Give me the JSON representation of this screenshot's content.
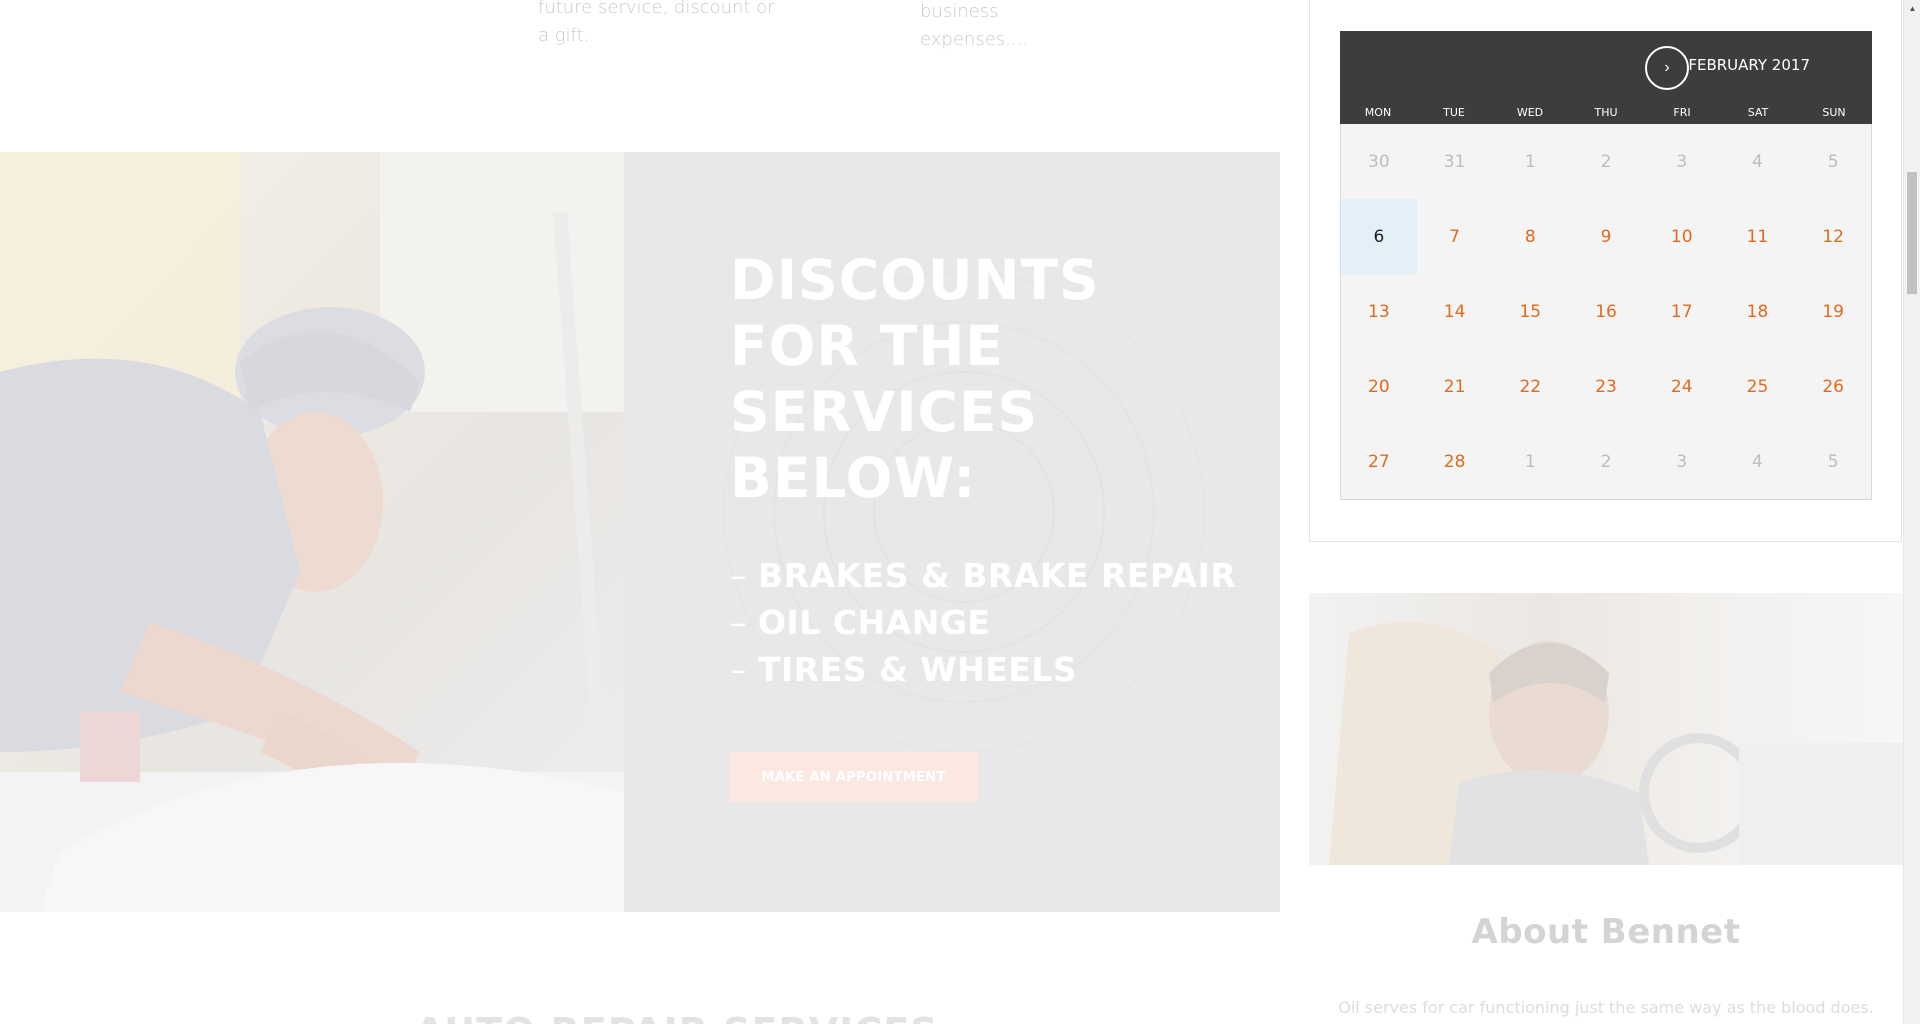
{
  "features": {
    "left_text": "future service, discount or a gift.",
    "right_text": "business expenses...."
  },
  "promo": {
    "title": "DISCOUNTS FOR THE SERVICES BELOW:",
    "services": [
      "BRAKES & BRAKE REPAIR",
      "OIL CHANGE",
      "TIRES & WHEELS"
    ],
    "button_label": "MAKE AN APPOINTMENT"
  },
  "section_heading": "AUTO REPAIR SERVICES",
  "calendar": {
    "month_label": "FEBRUARY 2017",
    "next_icon": "chevron-right-icon",
    "weekdays": [
      "MON",
      "TUE",
      "WED",
      "THU",
      "FRI",
      "SAT",
      "SUN"
    ],
    "weeks": [
      [
        "30",
        "31",
        "1",
        "2",
        "3",
        "4",
        "5"
      ],
      [
        "6",
        "7",
        "8",
        "9",
        "10",
        "11",
        "12"
      ],
      [
        "13",
        "14",
        "15",
        "16",
        "17",
        "18",
        "19"
      ],
      [
        "20",
        "21",
        "22",
        "23",
        "24",
        "25",
        "26"
      ],
      [
        "27",
        "28",
        "1",
        "2",
        "3",
        "4",
        "5"
      ]
    ],
    "today": "6",
    "colors": {
      "header_bg": "#3d3d3d",
      "day_link": "#e26a1e",
      "muted": "#bdbdbd",
      "today_bg": "#e4f0f8"
    }
  },
  "about": {
    "title": "About Bennet",
    "text": "Oil serves for car functioning just the same way as the blood does."
  }
}
